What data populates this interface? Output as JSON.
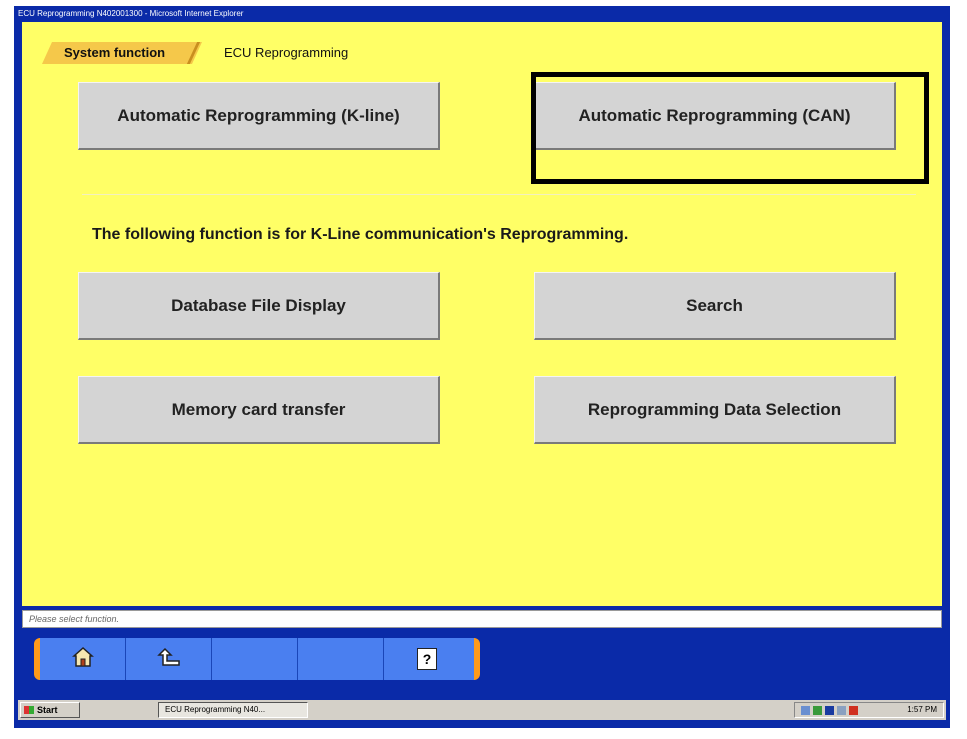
{
  "window": {
    "title": "ECU Reprogramming N402001300 - Microsoft Internet Explorer"
  },
  "breadcrumb": {
    "tab_active": "System function",
    "tab_current": "ECU Reprogramming"
  },
  "buttons": {
    "auto_kline": "Automatic Reprogramming (K-line)",
    "auto_can": "Automatic Reprogramming (CAN)",
    "db_file_display": "Database File Display",
    "search": "Search",
    "memory_card_transfer": "Memory card transfer",
    "data_selection": "Reprogramming Data Selection"
  },
  "info_text": "The following function is for K-Line communication's Reprogramming.",
  "status_bar": "Please select function.",
  "toolbar": {
    "icons": [
      "home-icon",
      "back-icon",
      "blank",
      "blank",
      "help-icon"
    ],
    "help_glyph": "?"
  },
  "taskbar": {
    "start_label": "Start",
    "task_label": "ECU Reprogramming N40...",
    "clock": "1:57 PM"
  },
  "colors": {
    "background": "#ffff66",
    "tab_active": "#f5c84a",
    "button": "#d4d4d4",
    "frame": "#0a2aa8",
    "toolbar": "#4a7ff0",
    "toolbar_border": "#ff9a1a"
  }
}
